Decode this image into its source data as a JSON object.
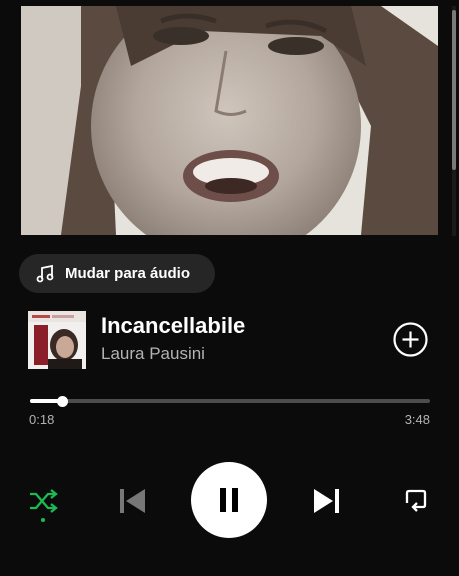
{
  "player": {
    "switch_to_audio_label": "Mudar para áudio",
    "track_title": "Incancellabile",
    "artist": "Laura Pausini",
    "elapsed": "0:18",
    "duration": "3:48",
    "progress": 0.079,
    "shuffle_active": true
  },
  "icons": {
    "music_note": "music-note-icon",
    "add": "plus-circle-icon",
    "shuffle": "shuffle-icon",
    "previous": "skip-previous-icon",
    "pause": "pause-icon",
    "next": "skip-next-icon",
    "repeat": "repeat-icon"
  },
  "colors": {
    "background": "#0b0b0b",
    "accent": "#1db954",
    "muted_text": "#b3b3b3"
  }
}
